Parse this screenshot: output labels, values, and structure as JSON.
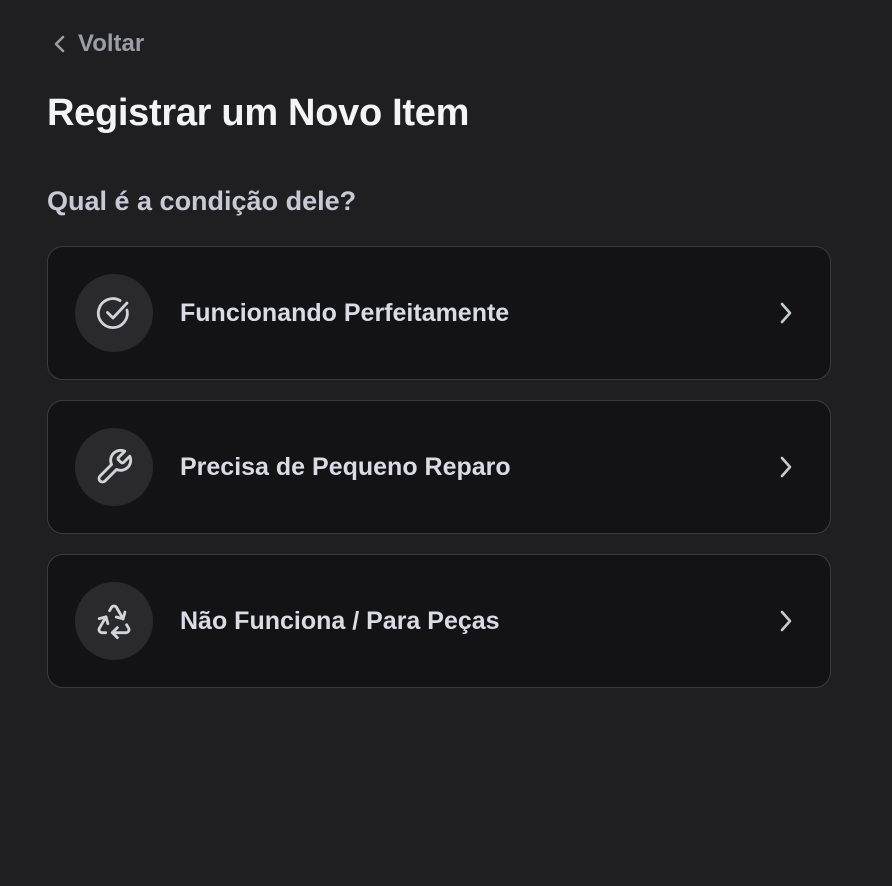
{
  "header": {
    "back_label": "Voltar",
    "title": "Registrar um Novo Item"
  },
  "question": "Qual é a condição dele?",
  "options": [
    {
      "label": "Funcionando Perfeitamente",
      "icon": "check-circle-icon"
    },
    {
      "label": "Precisa de Pequeno Reparo",
      "icon": "wrench-icon"
    },
    {
      "label": "Não Funciona / Para Peças",
      "icon": "recycle-icon"
    }
  ],
  "colors": {
    "background": "#1f1f22",
    "card": "#131315",
    "card_border": "#3a3b40",
    "icon_circle": "#2a2a2d",
    "text_primary": "#f3f4f8",
    "text_secondary": "#9a9ca6"
  }
}
